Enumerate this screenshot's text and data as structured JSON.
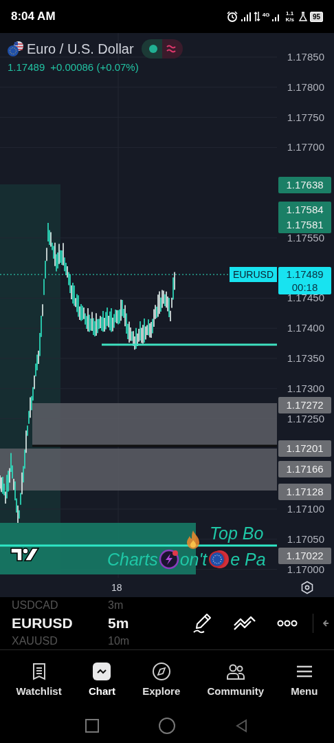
{
  "status_bar": {
    "time": "8:04 AM",
    "network": "4G",
    "speed": "1.1",
    "speed_unit": "K/s",
    "battery": "95"
  },
  "header": {
    "symbol_name": "Euro / U.S. Dollar",
    "price": "1.17489",
    "change": "+0.00086 (+0.07%)"
  },
  "price_axis": {
    "ticks": [
      "1.17850",
      "1.17800",
      "1.17750",
      "1.17700",
      "1.17550",
      "1.17450",
      "1.17400",
      "1.17350",
      "1.17300",
      "1.17250",
      "1.17100",
      "1.17050",
      "1.17000"
    ]
  },
  "price_tags": [
    {
      "lines": [
        "1.17638"
      ],
      "color": "#1b7f66"
    },
    {
      "lines": [
        "1.17584",
        "1.17581"
      ],
      "color": "#1b7f66"
    },
    {
      "lines": [
        "1.17272"
      ],
      "color": "#6b6d72"
    },
    {
      "lines": [
        "1.17201"
      ],
      "color": "#6b6d72"
    },
    {
      "lines": [
        "1.17166"
      ],
      "color": "#6b6d72"
    },
    {
      "lines": [
        "1.17128"
      ],
      "color": "#6b6d72"
    },
    {
      "lines": [
        "1.17022"
      ],
      "color": "#6b6d72"
    }
  ],
  "last_price": {
    "symbol": "EURUSD",
    "price": "1.17489",
    "countdown": "00:18"
  },
  "chart_texts": {
    "line_1": "Top Bo",
    "line_2_parts": [
      "Charts",
      "on't",
      "e Pa"
    ]
  },
  "time_axis": {
    "labels": [
      "18"
    ]
  },
  "symbol_picker": [
    {
      "symbol": "USDCAD",
      "interval": "3m",
      "selected": false
    },
    {
      "symbol": "EURUSD",
      "interval": "5m",
      "selected": true
    },
    {
      "symbol": "XAUUSD",
      "interval": "10m",
      "selected": false
    }
  ],
  "bottom_nav": [
    {
      "label": "Watchlist",
      "kind": "watchlist",
      "selected": false
    },
    {
      "label": "Chart",
      "kind": "chart",
      "selected": true
    },
    {
      "label": "Explore",
      "kind": "explore",
      "selected": false
    },
    {
      "label": "Community",
      "kind": "community",
      "selected": false
    },
    {
      "label": "Menu",
      "kind": "menu",
      "selected": false
    }
  ]
}
